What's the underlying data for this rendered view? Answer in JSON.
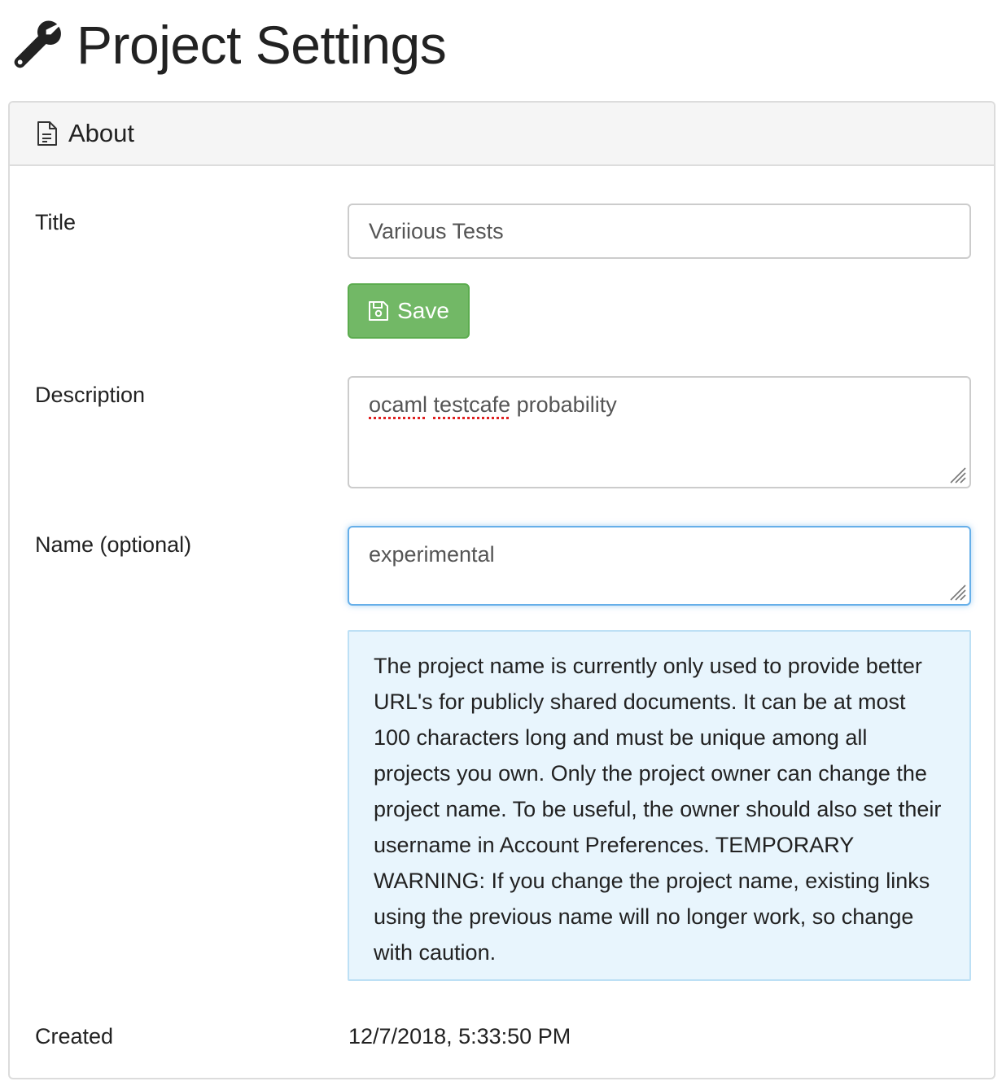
{
  "page": {
    "title": "Project Settings",
    "icon": "wrench-icon"
  },
  "panel": {
    "heading": "About",
    "heading_icon": "file-text-icon"
  },
  "title_field": {
    "label": "Title",
    "value": "Variious Tests"
  },
  "save_button": {
    "label": "Save",
    "icon": "save-icon",
    "color": "#72b866"
  },
  "description_field": {
    "label": "Description",
    "value_words": [
      "ocaml",
      "testcafe",
      "probability"
    ],
    "misspelled_words": [
      "ocaml",
      "testcafe"
    ]
  },
  "name_field": {
    "label": "Name (optional)",
    "value": "experimental",
    "focus_color": "#66afe9"
  },
  "name_info": {
    "text": "The project name is currently only used to provide better URL's for publicly shared documents. It can be at most 100 characters long and must be unique among all projects you own. Only the project owner can change the project name. To be useful, the owner should also set their username in Account Preferences. TEMPORARY WARNING: If you change the project name, existing links using the previous name will no longer work, so change with caution.",
    "background_color": "#e8f5fd"
  },
  "created": {
    "label": "Created",
    "value": "12/7/2018, 5:33:50 PM"
  }
}
